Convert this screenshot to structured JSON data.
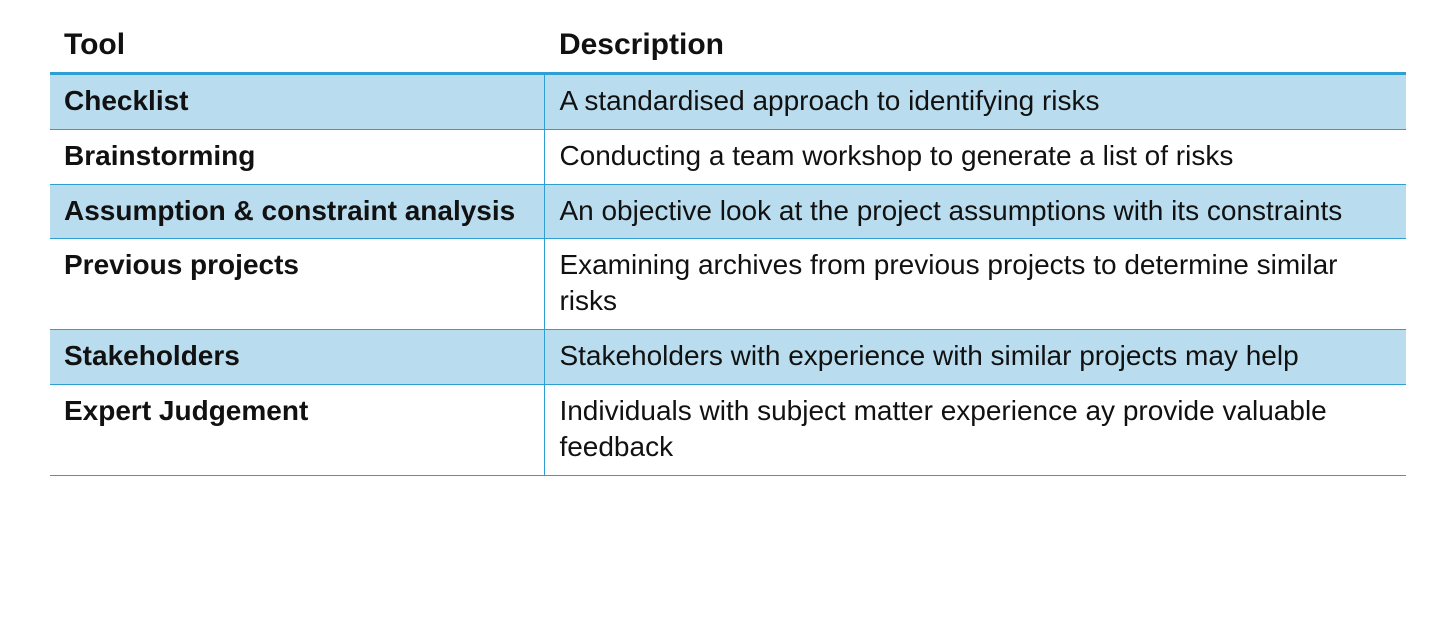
{
  "table": {
    "headers": {
      "tool": "Tool",
      "description": "Description"
    },
    "rows": [
      {
        "tool": "Checklist",
        "description": "A standardised approach to identifying risks"
      },
      {
        "tool": "Brainstorming",
        "description": "Conducting a team workshop to generate a list of risks"
      },
      {
        "tool": "Assumption & constraint analysis",
        "description": "An objective look at the project assumptions with its constraints"
      },
      {
        "tool": "Previous projects",
        "description": "Examining archives from previous projects to determine similar risks"
      },
      {
        "tool": "Stakeholders",
        "description": "Stakeholders with experience with similar projects may help"
      },
      {
        "tool": "Expert Judgement",
        "description": "Individuals with subject matter experience ay provide valuable feedback"
      }
    ]
  }
}
